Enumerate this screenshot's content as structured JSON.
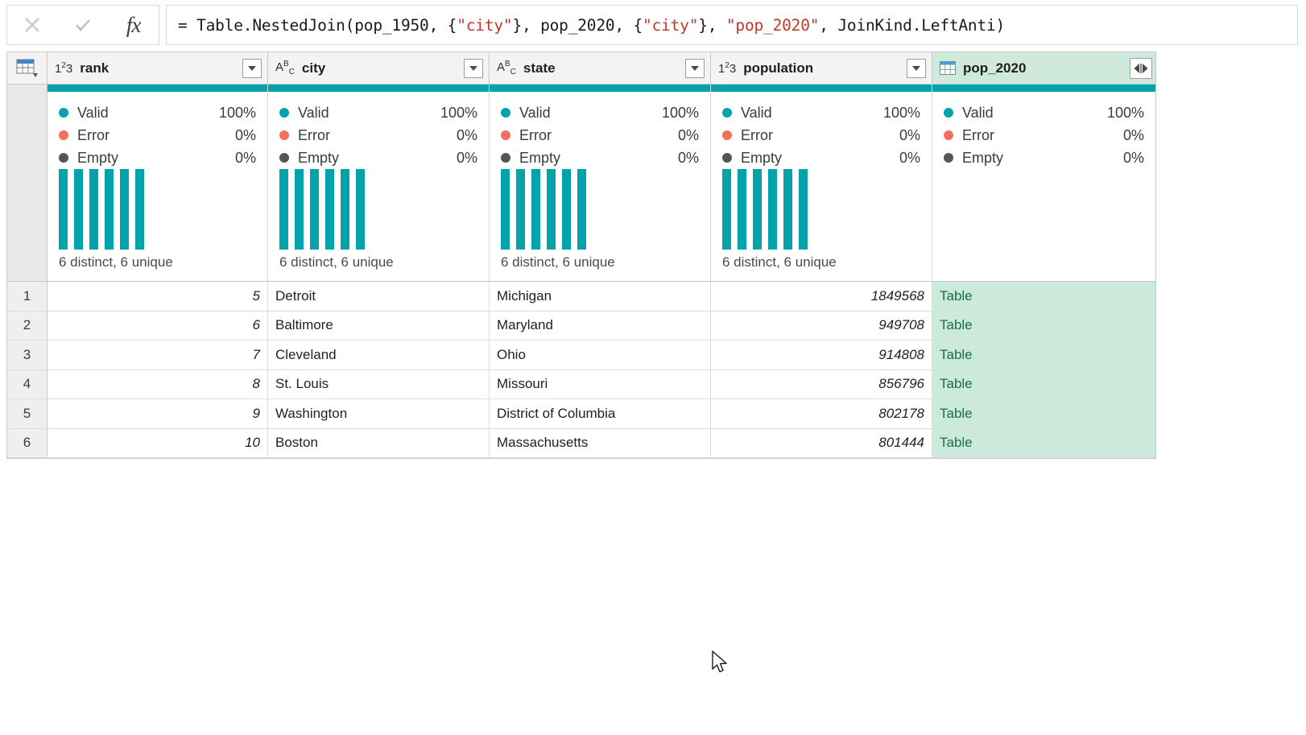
{
  "formula_bar": {
    "cancel_label": "✕",
    "accept_label": "✓",
    "fx_label": "fx",
    "formula_prefix": "= Table.NestedJoin(pop_1950, {",
    "formula_str1": "\"city\"",
    "formula_mid1": "}, pop_2020, {",
    "formula_str2": "\"city\"",
    "formula_mid2": "}, ",
    "formula_str3": "\"pop_2020\"",
    "formula_suffix": ", JoinKind.LeftAnti)",
    "formula_full": "= Table.NestedJoin(pop_1950, {\"city\"}, pop_2020, {\"city\"}, \"pop_2020\", JoinKind.LeftAnti)"
  },
  "colors": {
    "quality_valid": "#04a3ab",
    "quality_error": "#f4705a",
    "quality_empty": "#555555",
    "nested_table_bg": "#cbeadb",
    "nested_table_text": "#1d6b4a",
    "header_bg": "#f3f3f3"
  },
  "table": {
    "columns": [
      {
        "name": "rank",
        "type_icon": "123",
        "type": "number",
        "has_filter": true,
        "is_nested": false
      },
      {
        "name": "city",
        "type_icon": "ABC",
        "type": "text",
        "has_filter": true,
        "is_nested": false
      },
      {
        "name": "state",
        "type_icon": "ABC",
        "type": "text",
        "has_filter": true,
        "is_nested": false
      },
      {
        "name": "population",
        "type_icon": "123",
        "type": "number",
        "has_filter": true,
        "is_nested": false
      },
      {
        "name": "pop_2020",
        "type_icon": "table",
        "type": "table",
        "has_filter": false,
        "is_nested": true
      }
    ],
    "quality": [
      {
        "valid_label": "Valid",
        "valid_value": "100%",
        "error_label": "Error",
        "error_value": "0%",
        "empty_label": "Empty",
        "empty_value": "0%",
        "footer": "6 distinct, 6 unique",
        "histogram": [
          1,
          1,
          1,
          1,
          1,
          1
        ]
      },
      {
        "valid_label": "Valid",
        "valid_value": "100%",
        "error_label": "Error",
        "error_value": "0%",
        "empty_label": "Empty",
        "empty_value": "0%",
        "footer": "6 distinct, 6 unique",
        "histogram": [
          1,
          1,
          1,
          1,
          1,
          1
        ]
      },
      {
        "valid_label": "Valid",
        "valid_value": "100%",
        "error_label": "Error",
        "error_value": "0%",
        "empty_label": "Empty",
        "empty_value": "0%",
        "footer": "6 distinct, 6 unique",
        "histogram": [
          1,
          1,
          1,
          1,
          1,
          1
        ]
      },
      {
        "valid_label": "Valid",
        "valid_value": "100%",
        "error_label": "Error",
        "error_value": "0%",
        "empty_label": "Empty",
        "empty_value": "0%",
        "footer": "6 distinct, 6 unique",
        "histogram": [
          1,
          1,
          1,
          1,
          1,
          1
        ]
      },
      {
        "valid_label": "Valid",
        "valid_value": "100%",
        "error_label": "Error",
        "error_value": "0%",
        "empty_label": "Empty",
        "empty_value": "0%",
        "footer": "",
        "histogram": []
      }
    ],
    "rows": [
      {
        "num": "1",
        "rank": "5",
        "city": "Detroit",
        "state": "Michigan",
        "population": "1849568",
        "pop_2020": "Table"
      },
      {
        "num": "2",
        "rank": "6",
        "city": "Baltimore",
        "state": "Maryland",
        "population": "949708",
        "pop_2020": "Table"
      },
      {
        "num": "3",
        "rank": "7",
        "city": "Cleveland",
        "state": "Ohio",
        "population": "914808",
        "pop_2020": "Table"
      },
      {
        "num": "4",
        "rank": "8",
        "city": "St. Louis",
        "state": "Missouri",
        "population": "856796",
        "pop_2020": "Table"
      },
      {
        "num": "5",
        "rank": "9",
        "city": "Washington",
        "state": "District of Columbia",
        "population": "802178",
        "pop_2020": "Table"
      },
      {
        "num": "6",
        "rank": "10",
        "city": "Boston",
        "state": "Massachusetts",
        "population": "801444",
        "pop_2020": "Table"
      }
    ]
  }
}
